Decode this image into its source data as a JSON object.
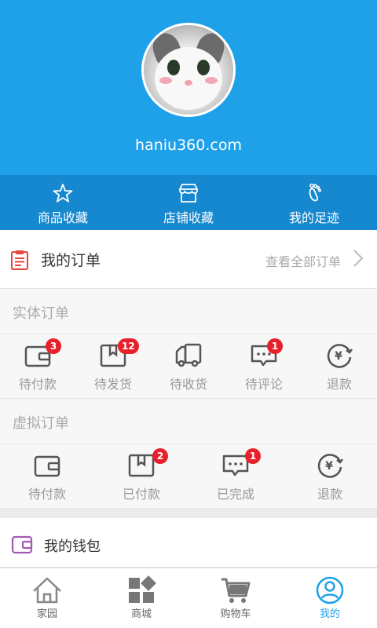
{
  "profile": {
    "site_name": "haniu360.com",
    "avatar_icon": "cat-avatar"
  },
  "favorites": [
    {
      "label": "商品收藏",
      "icon": "star-icon"
    },
    {
      "label": "店铺收藏",
      "icon": "store-icon"
    },
    {
      "label": "我的足迹",
      "icon": "footprint-icon"
    }
  ],
  "orders": {
    "title": "我的订单",
    "view_all": "查看全部订单",
    "physical": {
      "label": "实体订单",
      "items": [
        {
          "label": "待付款",
          "badge": "3",
          "icon": "wallet-icon"
        },
        {
          "label": "待发货",
          "badge": "12",
          "icon": "box-icon"
        },
        {
          "label": "待收货",
          "badge": "",
          "icon": "truck-icon"
        },
        {
          "label": "待评论",
          "badge": "1",
          "icon": "comment-icon"
        },
        {
          "label": "退款",
          "badge": "",
          "icon": "refund-icon"
        }
      ]
    },
    "virtual": {
      "label": "虚拟订单",
      "items": [
        {
          "label": "待付款",
          "badge": "",
          "icon": "wallet-icon"
        },
        {
          "label": "已付款",
          "badge": "2",
          "icon": "box-icon"
        },
        {
          "label": "已完成",
          "badge": "1",
          "icon": "comment-icon"
        },
        {
          "label": "退款",
          "badge": "",
          "icon": "refund-icon"
        }
      ]
    }
  },
  "wallet": {
    "title": "我的钱包"
  },
  "tabs": [
    {
      "label": "家园",
      "icon": "home-icon",
      "active": false
    },
    {
      "label": "商城",
      "icon": "grid-icon",
      "active": false
    },
    {
      "label": "购物车",
      "icon": "cart-icon",
      "active": false
    },
    {
      "label": "我的",
      "icon": "user-icon",
      "active": true
    }
  ],
  "colors": {
    "primary": "#1ea1e8",
    "primary_dark": "#1588cf",
    "badge": "#e8202a",
    "orders_icon": "#e8453c",
    "wallet_icon": "#a25bb5"
  }
}
